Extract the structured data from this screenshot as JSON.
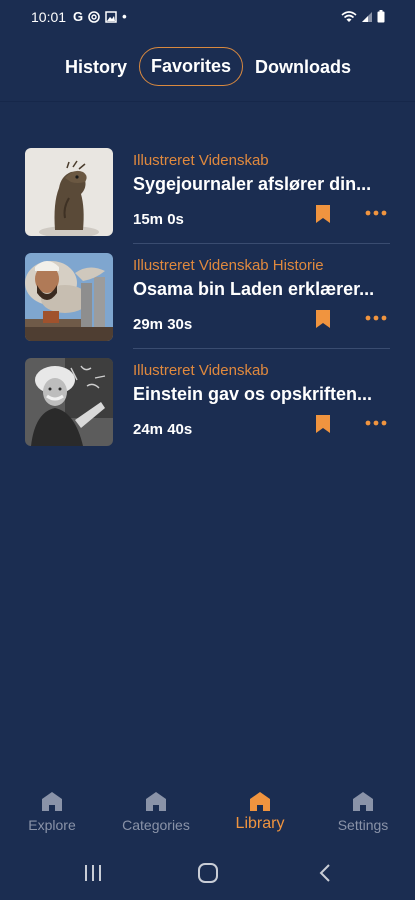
{
  "status_bar": {
    "time": "10:01",
    "left_icons": [
      "G",
      "email-icon",
      "image-icon",
      "•"
    ],
    "right_icons": [
      "wifi-icon",
      "signal-icon",
      "battery-icon"
    ]
  },
  "tabs": [
    {
      "label": "History",
      "active": false
    },
    {
      "label": "Favorites",
      "active": true
    },
    {
      "label": "Downloads",
      "active": false
    }
  ],
  "favorites": [
    {
      "source": "Illustreret Videnskab",
      "title": "Sygejournaler afslører din...",
      "duration": "15m 0s",
      "thumb": "creature-figure",
      "bookmarked": true
    },
    {
      "source": "Illustreret Videnskab Historie",
      "title": "Osama bin Laden erklærer...",
      "duration": "29m 30s",
      "thumb": "bin-laden-towers",
      "bookmarked": true
    },
    {
      "source": "Illustreret Videnskab",
      "title": "Einstein gav os opskriften...",
      "duration": "24m 40s",
      "thumb": "einstein-chalkboard",
      "bookmarked": true
    }
  ],
  "bottom_nav": [
    {
      "label": "Explore",
      "icon": "home-icon",
      "active": false
    },
    {
      "label": "Categories",
      "icon": "home-icon",
      "active": false
    },
    {
      "label": "Library",
      "icon": "home-icon",
      "active": true
    },
    {
      "label": "Settings",
      "icon": "home-icon",
      "active": false
    }
  ],
  "colors": {
    "background": "#1b2d51",
    "accent": "#f0943f",
    "source_text": "#e0893e",
    "inactive_nav": "#8a93a8"
  }
}
